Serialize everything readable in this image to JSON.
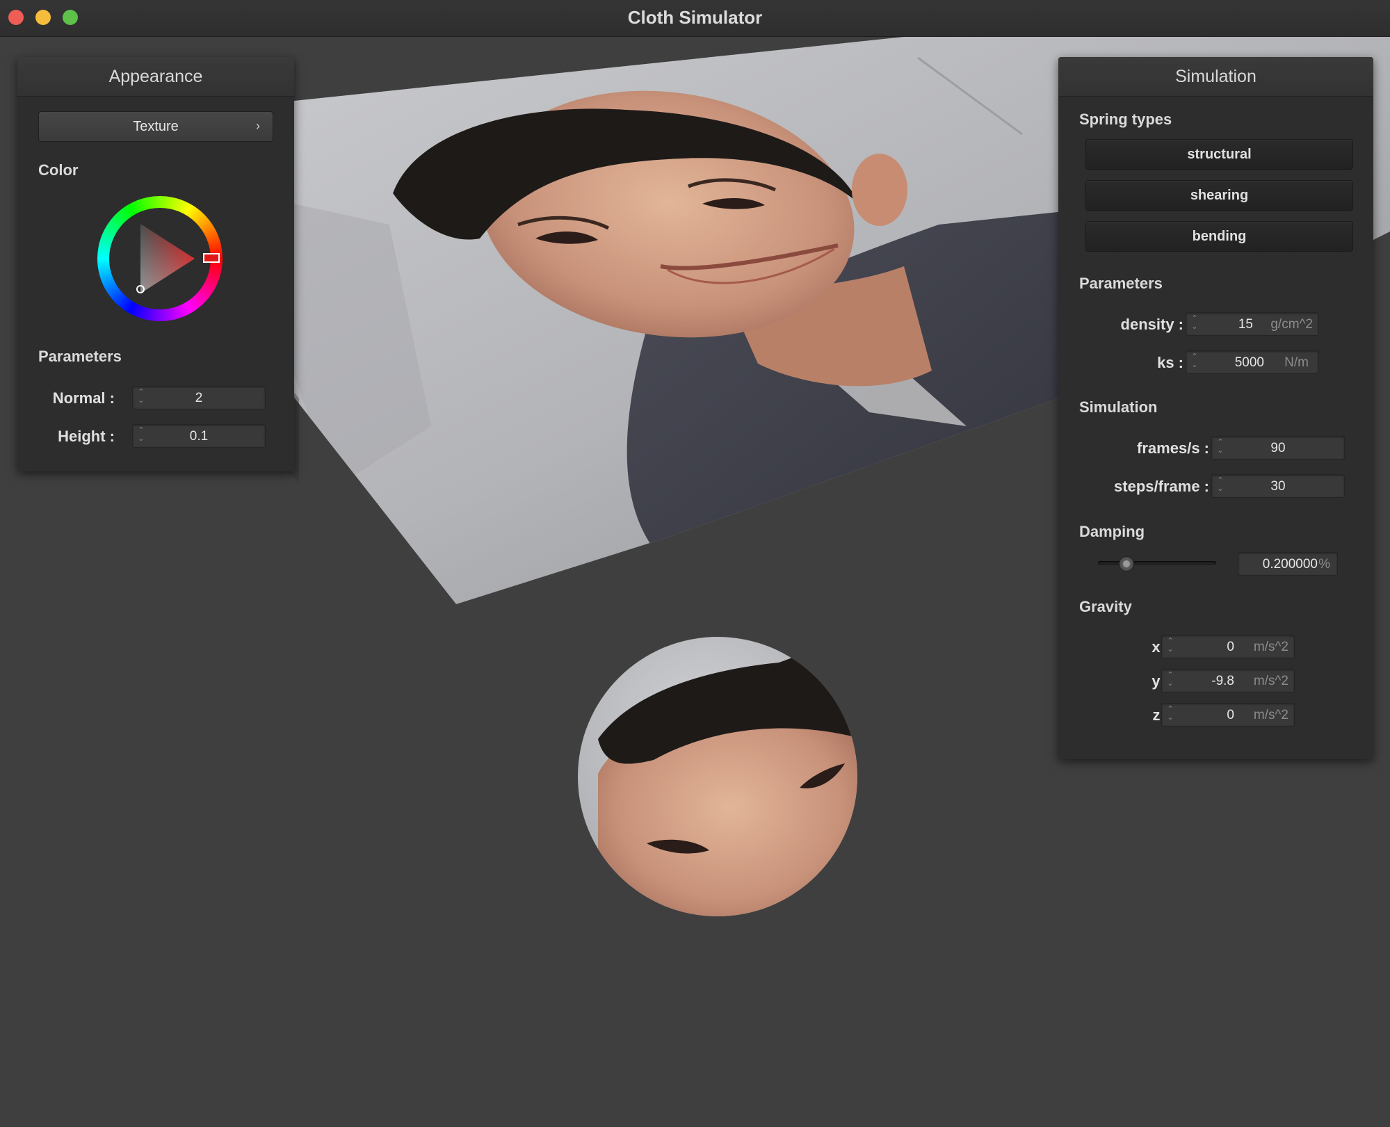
{
  "window": {
    "title": "Cloth Simulator"
  },
  "appearance": {
    "header": "Appearance",
    "texture_button": "Texture",
    "color_label": "Color",
    "parameters_label": "Parameters",
    "normal": {
      "label": "Normal :",
      "value": "2"
    },
    "height": {
      "label": "Height :",
      "value": "0.1"
    },
    "selected_color": "#d01d1d"
  },
  "simulation": {
    "header": "Simulation",
    "spring_types_label": "Spring types",
    "spring_types": [
      "structural",
      "shearing",
      "bending"
    ],
    "parameters_label": "Parameters",
    "density": {
      "label": "density :",
      "value": "15",
      "unit": "g/cm^2"
    },
    "ks": {
      "label": "ks :",
      "value": "5000",
      "unit": "N/m"
    },
    "simulation_label": "Simulation",
    "frames_per_s": {
      "label": "frames/s :",
      "value": "90"
    },
    "steps_per_frame": {
      "label": "steps/frame :",
      "value": "30"
    },
    "damping_label": "Damping",
    "damping": {
      "value": "0.200000",
      "unit": "%",
      "slider_fraction": 0.2
    },
    "gravity_label": "Gravity",
    "gravity": {
      "x": {
        "label": "x :",
        "value": "0",
        "unit": "m/s^2"
      },
      "y": {
        "label": "y :",
        "value": "-9.8",
        "unit": "m/s^2"
      },
      "z": {
        "label": "z :",
        "value": "0",
        "unit": "m/s^2"
      }
    }
  }
}
